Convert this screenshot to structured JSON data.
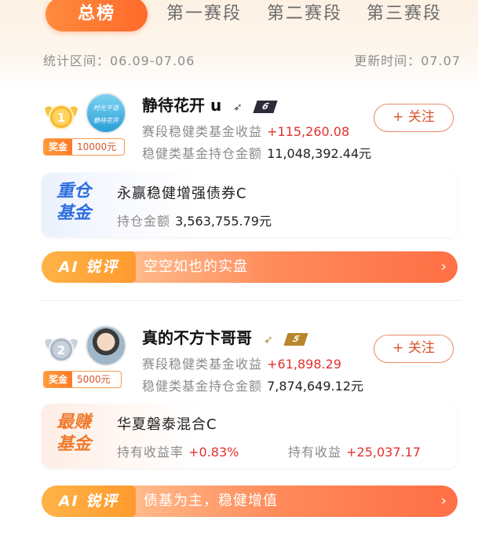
{
  "tabs": [
    {
      "label": "总榜",
      "active": true
    },
    {
      "label": "第一赛段"
    },
    {
      "label": "第二赛段"
    },
    {
      "label": "第三赛段"
    }
  ],
  "meta": {
    "period": "统计区间：06.09-07.06",
    "updated": "更新时间：07.07"
  },
  "entries": [
    {
      "rank": "1",
      "reward_label": "奖金",
      "reward_value": "10000元",
      "avatar_text_top": "时光不语",
      "avatar_text_bottom": "静待花开",
      "name": "静待花开 u",
      "level": "6",
      "stage_return_label": "赛段稳健类基金收益",
      "stage_return_value": "+115,260.08",
      "holding_label": "稳健类基金持仓金额",
      "holding_value": "11,048,392.44元",
      "follow_label": "+ 关注",
      "fund_tag_line1": "重仓",
      "fund_tag_line2": "基金",
      "fund_name": "永赢稳健增强债券C",
      "fund_sub1_label": "持仓金额",
      "fund_sub1_value": "3,563,755.79元",
      "ai_label": "AI 锐评",
      "ai_comment": "空空如也的实盘"
    },
    {
      "rank": "2",
      "reward_label": "奖金",
      "reward_value": "5000元",
      "name": "真的不方卞哥哥",
      "level": "5",
      "stage_return_label": "赛段稳健类基金收益",
      "stage_return_value": "+61,898.29",
      "holding_label": "稳健类基金持仓金额",
      "holding_value": "7,874,649.12元",
      "follow_label": "+ 关注",
      "fund_tag_line1": "最赚",
      "fund_tag_line2": "基金",
      "fund_name": "华夏磐泰混合C",
      "fund_sub1_label": "持有收益率",
      "fund_sub1_value": "+0.83%",
      "fund_sub2_label": "持有收益",
      "fund_sub2_value": "+25,037.17",
      "ai_label": "AI 锐评",
      "ai_comment": "债基为主，稳健增值"
    }
  ],
  "colors": {
    "accent": "#ff6a2a",
    "profit_red": "#e0322c",
    "tag_blue": "#2f6fe0",
    "tag_orange": "#f07a2c"
  }
}
